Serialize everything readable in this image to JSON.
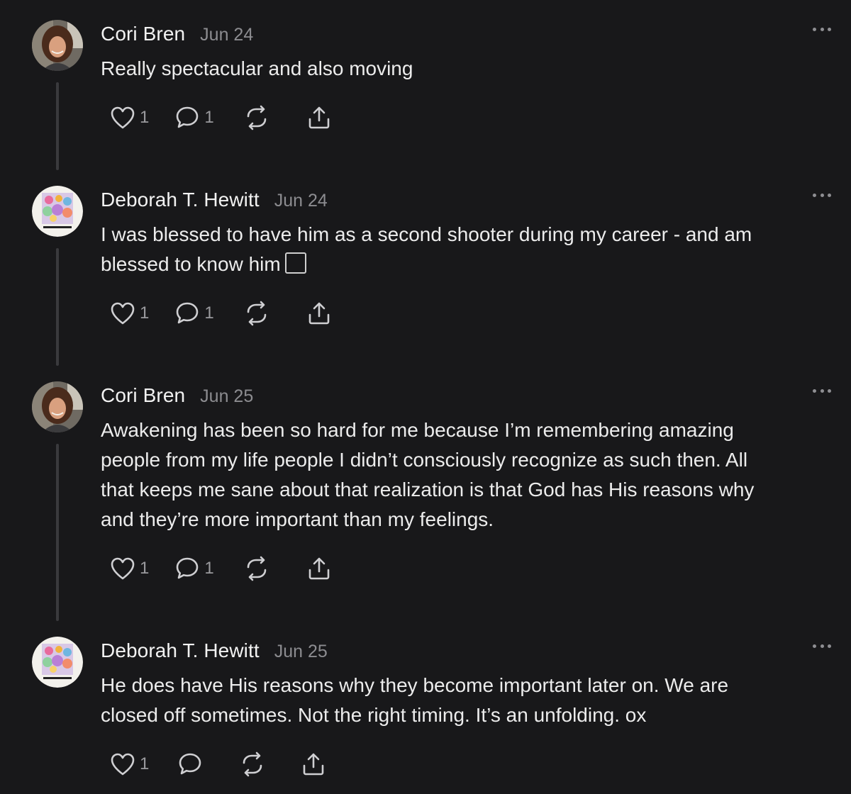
{
  "comments": [
    {
      "author": "Cori Bren",
      "date": "Jun 24",
      "lines": [
        "Really spectacular and also moving"
      ],
      "likes": "1",
      "replies": "1"
    },
    {
      "author": "Deborah T. Hewitt",
      "date": "Jun 24",
      "lines": [
        "I was blessed to have him as a second shooter during my career - and am",
        "blessed to know him"
      ],
      "likes": "1",
      "replies": "1"
    },
    {
      "author": "Cori Bren",
      "date": "Jun 25",
      "lines": [
        "Awakening has been so hard for me because I’m remembering amazing",
        "people from my life people I didn’t consciously recognize as such then. All",
        "that keeps me sane about that realization is that God has His reasons why",
        "and they’re more important than my feelings."
      ],
      "likes": "1",
      "replies": "1"
    },
    {
      "author": "Deborah T. Hewitt",
      "date": "Jun 25",
      "lines": [
        "He does have His reasons why they become important later on. We are",
        "closed off sometimes. Not the right timing. It’s an unfolding. ox"
      ],
      "likes": "1",
      "replies": ""
    }
  ],
  "icons": {
    "like": "heart-icon",
    "reply": "comment-bubble-icon",
    "restack": "restack-icon",
    "share": "share-icon",
    "more": "more-options-icon"
  },
  "colors": {
    "background": "#18181a",
    "text": "#ececec",
    "muted": "#8c8c90"
  }
}
